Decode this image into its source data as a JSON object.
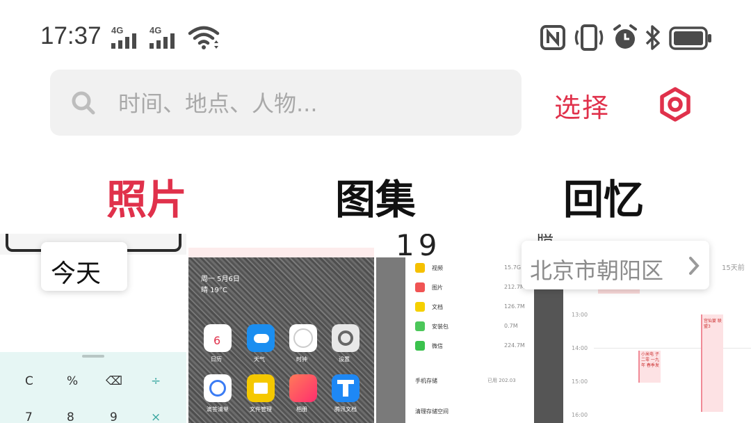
{
  "status_bar": {
    "time": "17:37",
    "sim1": "4G",
    "sim2": "4G",
    "icons": [
      "nfc-icon",
      "vibrate-icon",
      "alarm-icon",
      "bluetooth-icon",
      "battery-icon"
    ]
  },
  "search": {
    "placeholder": "时间、地点、人物..."
  },
  "header": {
    "select_label": "选择",
    "settings_icon": "settings-icon"
  },
  "tabs": [
    {
      "label": "照片",
      "active": true
    },
    {
      "label": "图集",
      "active": false
    },
    {
      "label": "回忆",
      "active": false
    }
  ],
  "groups": {
    "today_label": "今天",
    "location_label": "北京市朝阳区"
  },
  "thumbnails": {
    "calculator": {
      "keys_row1": [
        "C",
        "%",
        "⌫",
        "÷"
      ],
      "keys_row2": [
        "7",
        "8",
        "9",
        "×"
      ]
    },
    "home_screen": {
      "date": "周一 5月6日",
      "weather": "晴 19°C",
      "calendar_day": "6",
      "app_labels_row1": [
        "日历",
        "天气",
        "时钟",
        "设置"
      ],
      "app_labels_row2": [
        "滴答清单",
        "文件管理",
        "相册",
        "腾讯文档"
      ]
    },
    "storage": {
      "big_digits": "19",
      "rows": [
        {
          "name": "视频",
          "size": "15.7G"
        },
        {
          "name": "图片",
          "size": "212.7M"
        },
        {
          "name": "文档",
          "size": "126.7M"
        },
        {
          "name": "安装包",
          "size": "0.7M"
        },
        {
          "name": "微信",
          "size": "224.7M"
        }
      ],
      "phone_storage": "手机存储",
      "phone_storage_value": "已用 202.03",
      "cleanup": "清理存储空间"
    },
    "calendar": {
      "header_fragment": "暗",
      "days_ago": "15天前",
      "times": [
        "13:00",
        "14:00",
        "15:00",
        "16:00"
      ],
      "event1": "宫仙宴 联盟3",
      "event2": "小米电 子二零 一九年 春季发"
    }
  },
  "colors": {
    "accent": "#e0314b",
    "search_bg": "#f1f1f1"
  }
}
